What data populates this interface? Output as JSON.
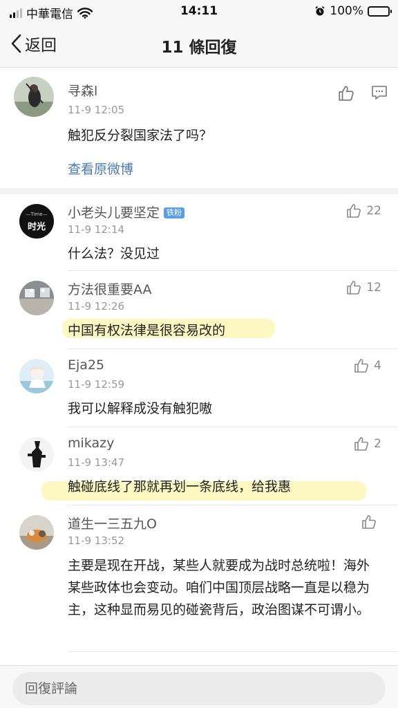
{
  "status_bar": {
    "carrier": "中華電信",
    "time": "14:11",
    "battery": "100%",
    "battery_level": 1.0
  },
  "nav": {
    "back_label": "返回",
    "title": "11 條回復"
  },
  "original": {
    "username": "寻森l",
    "time": "11-9 12:05",
    "text": "触犯反分裂国家法了吗？",
    "view_link": "查看原微博"
  },
  "comments": [
    {
      "username": "小老头儿要坚定",
      "badge": "铁粉",
      "time": "11-9 12:14",
      "text": "什么法？没见过",
      "likes": "22",
      "avatar_text": "时光",
      "avatar_sub": "—Time—"
    },
    {
      "username": "方法很重要AA",
      "time": "11-9 12:26",
      "text": "中国有权法律是很容易改的",
      "likes": "12"
    },
    {
      "username": "Eja25",
      "time": "11-9 12:59",
      "text": "我可以解释成没有触犯嗷",
      "likes": "4"
    },
    {
      "username": "mikazy",
      "time": "11-9 13:47",
      "text": "触碰底线了那就再划一条底线，给我惠",
      "likes": "2"
    },
    {
      "username": "道生一三五九O",
      "time": "11-9 13:52",
      "text": "主要是现在开战，某些人就要成为战时总统啦！海外某些政体也会变动。咱们中国顶层战略一直是以稳为主，这种显而易见的碰瓷背后，政治图谋不可谓小。",
      "likes": ""
    }
  ],
  "reply_input": {
    "placeholder": "回復評論"
  },
  "colors": {
    "link": "#4a7ab5",
    "highlight": "#faee6e",
    "badge": "#5a9fe6"
  }
}
